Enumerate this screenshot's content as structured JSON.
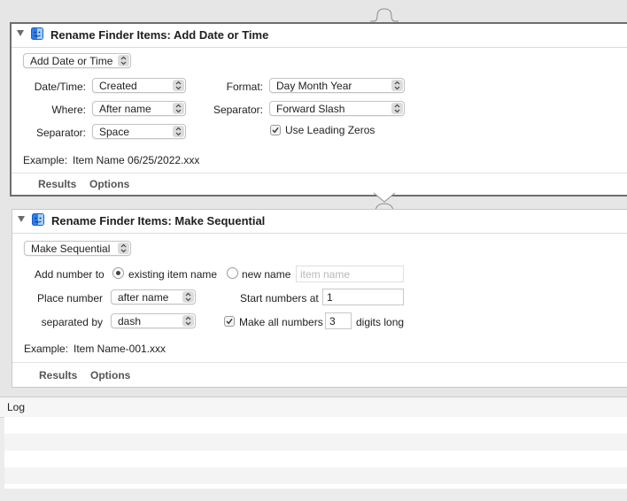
{
  "action1": {
    "title": "Rename Finder Items: Add Date or Time",
    "mode_popup": "Add Date or Time",
    "datetime_label": "Date/Time:",
    "datetime_value": "Created",
    "where_label": "Where:",
    "where_value": "After name",
    "separator_label": "Separator:",
    "separator_value": "Space",
    "format_label": "Format:",
    "format_value": "Day Month Year",
    "separator2_label": "Separator:",
    "separator2_value": "Forward Slash",
    "leading_zeros_label": "Use Leading Zeros",
    "leading_zeros_checked": true,
    "example_label": "Example:",
    "example_value": "Item Name 06/25/2022.xxx",
    "results_tab": "Results",
    "options_tab": "Options"
  },
  "action2": {
    "title": "Rename Finder Items: Make Sequential",
    "mode_popup": "Make Sequential",
    "add_number_label": "Add number to",
    "existing_name_label": "existing item name",
    "new_name_label": "new name",
    "new_name_placeholder": "item name",
    "place_number_label": "Place number",
    "place_number_value": "after name",
    "start_numbers_label": "Start numbers at",
    "start_numbers_value": "1",
    "separated_by_label": "separated by",
    "separated_by_value": "dash",
    "make_all_label": "Make all numbers",
    "digits_value": "3",
    "digits_long_label": "digits long",
    "example_label": "Example:",
    "example_value": "Item Name-001.xxx",
    "results_tab": "Results",
    "options_tab": "Options"
  },
  "log": {
    "header": "Log"
  },
  "colors": {
    "selection_border": "#6e6e6e",
    "panel_bg": "#ffffff",
    "canvas_bg": "#e6e6e6"
  }
}
